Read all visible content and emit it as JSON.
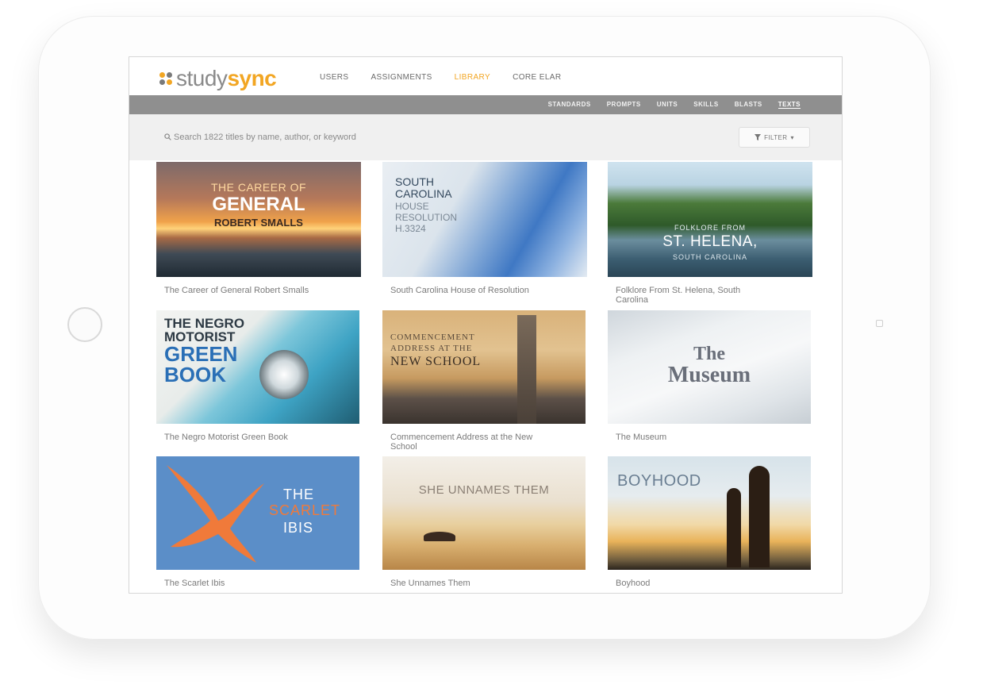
{
  "logo": {
    "study": "study",
    "sync": "sync"
  },
  "nav": [
    {
      "label": "USERS",
      "active": false
    },
    {
      "label": "ASSIGNMENTS",
      "active": false
    },
    {
      "label": "LIBRARY",
      "active": true
    },
    {
      "label": "CORE ELAR",
      "active": false
    }
  ],
  "subnav": [
    {
      "label": "STANDARDS",
      "active": false
    },
    {
      "label": "PROMPTS",
      "active": false
    },
    {
      "label": "UNITS",
      "active": false
    },
    {
      "label": "SKILLS",
      "active": false
    },
    {
      "label": "BLASTS",
      "active": false
    },
    {
      "label": "TEXTS",
      "active": true
    }
  ],
  "search": {
    "placeholder": "Search 1822 titles by name, author, or keyword"
  },
  "filter": {
    "label": "FILTER",
    "icon": "funnel-icon"
  },
  "colors": {
    "accent": "#f2a623",
    "subnav_bg": "#8f8f8f",
    "searchbar_bg": "#f0f0f0"
  },
  "cards": [
    {
      "caption": "The Career of General Robert Smalls",
      "thumb_text": [
        "THE CAREER OF",
        "GENERAL",
        "ROBERT SMALLS"
      ]
    },
    {
      "caption": "South Carolina House of Resolution",
      "thumb_text": [
        "SOUTH",
        "CAROLINA",
        "HOUSE",
        "RESOLUTION",
        "H.3324"
      ]
    },
    {
      "caption": "Folklore From St. Helena, South Carolina",
      "thumb_text": [
        "FOLKLORE FROM",
        "ST. HELENA,",
        "SOUTH CAROLINA"
      ]
    },
    {
      "caption": "The Negro Motorist Green Book",
      "thumb_text": [
        "THE NEGRO",
        "MOTORIST",
        "GREEN",
        "BOOK"
      ]
    },
    {
      "caption": "Commencement Address at the New School",
      "thumb_text": [
        "COMMENCEMENT",
        "ADDRESS AT THE",
        "NEW SCHOOL"
      ]
    },
    {
      "caption": "The Museum",
      "thumb_text": [
        "The",
        "Museum"
      ]
    },
    {
      "caption": "The Scarlet Ibis",
      "thumb_text": [
        "THE",
        "SCARLET",
        "IBIS"
      ]
    },
    {
      "caption": "She Unnames Them",
      "thumb_text": [
        "SHE UNNAMES THEM"
      ]
    },
    {
      "caption": "Boyhood",
      "thumb_text": [
        "BOYHOOD"
      ]
    }
  ]
}
